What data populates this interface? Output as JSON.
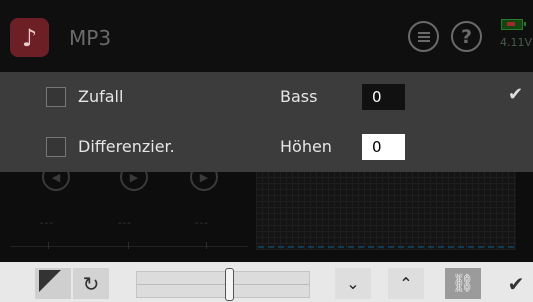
{
  "header": {
    "title": "MP3",
    "app_icon": "music-note-icon",
    "voltage": "4.11V",
    "help_label": "?"
  },
  "options": {
    "shuffle_label": "Zufall",
    "differential_label": "Differenzier.",
    "bass_label": "Bass",
    "bass_value": "0",
    "treble_label": "Höhen",
    "treble_value": "0"
  },
  "player": {
    "time_placeholder_1": "---",
    "time_placeholder_2": "---",
    "time_placeholder_3": "---"
  },
  "toolbar": {
    "icons": [
      "corner-icon",
      "refresh-icon",
      "slider",
      "chevron-down-icon",
      "chevron-up-icon",
      "link-icon",
      "check-icon"
    ]
  },
  "colors": {
    "app_icon_bg": "#6d1f26",
    "panel_bg": "#3c3c3c",
    "toolbar_bg": "#e8e8e8"
  }
}
